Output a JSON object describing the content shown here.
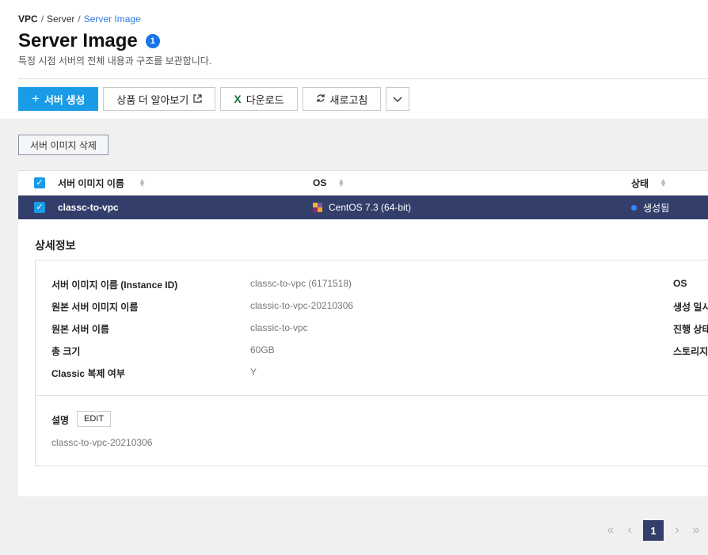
{
  "breadcrumb": {
    "root": "VPC",
    "sep": "/",
    "level2": "Server",
    "current": "Server Image"
  },
  "header": {
    "title": "Server Image",
    "badge": "1",
    "description": "특정 시점 서버의 전체 내용과 구조를 보관합니다."
  },
  "toolbar": {
    "create_label": "서버 생성",
    "learn_label": "상품 더 알아보기",
    "download_label": "다운로드",
    "refresh_label": "새로고침"
  },
  "actions": {
    "delete_label": "서버 이미지 삭제"
  },
  "table": {
    "columns": [
      "서버 이미지 이름",
      "OS",
      "상태"
    ],
    "rows": [
      {
        "name": "classc-to-vpc",
        "os": "CentOS 7.3 (64-bit)",
        "status": "생성됨"
      }
    ]
  },
  "details": {
    "title": "상세정보",
    "left": [
      {
        "label": "서버 이미지 이름 (Instance ID)",
        "value": "classc-to-vpc (6171518)"
      },
      {
        "label": "원본 서버 이미지 이름",
        "value": "classic-to-vpc-20210306"
      },
      {
        "label": "원본 서버 이름",
        "value": "classic-to-vpc"
      },
      {
        "label": "총 크기",
        "value": "60GB"
      },
      {
        "label": "Classic 복제 여부",
        "value": "Y"
      }
    ],
    "right_labels": [
      "OS",
      "생성 일시",
      "진행 상태",
      "스토리지"
    ],
    "description_label": "설명",
    "edit_label": "EDIT",
    "description_value": "classc-to-vpc-20210306"
  },
  "pagination": {
    "current_page": "1"
  },
  "colors": {
    "primary": "#1a9be6",
    "selected_row": "#333e6a",
    "status_created": "#2f8bff"
  }
}
